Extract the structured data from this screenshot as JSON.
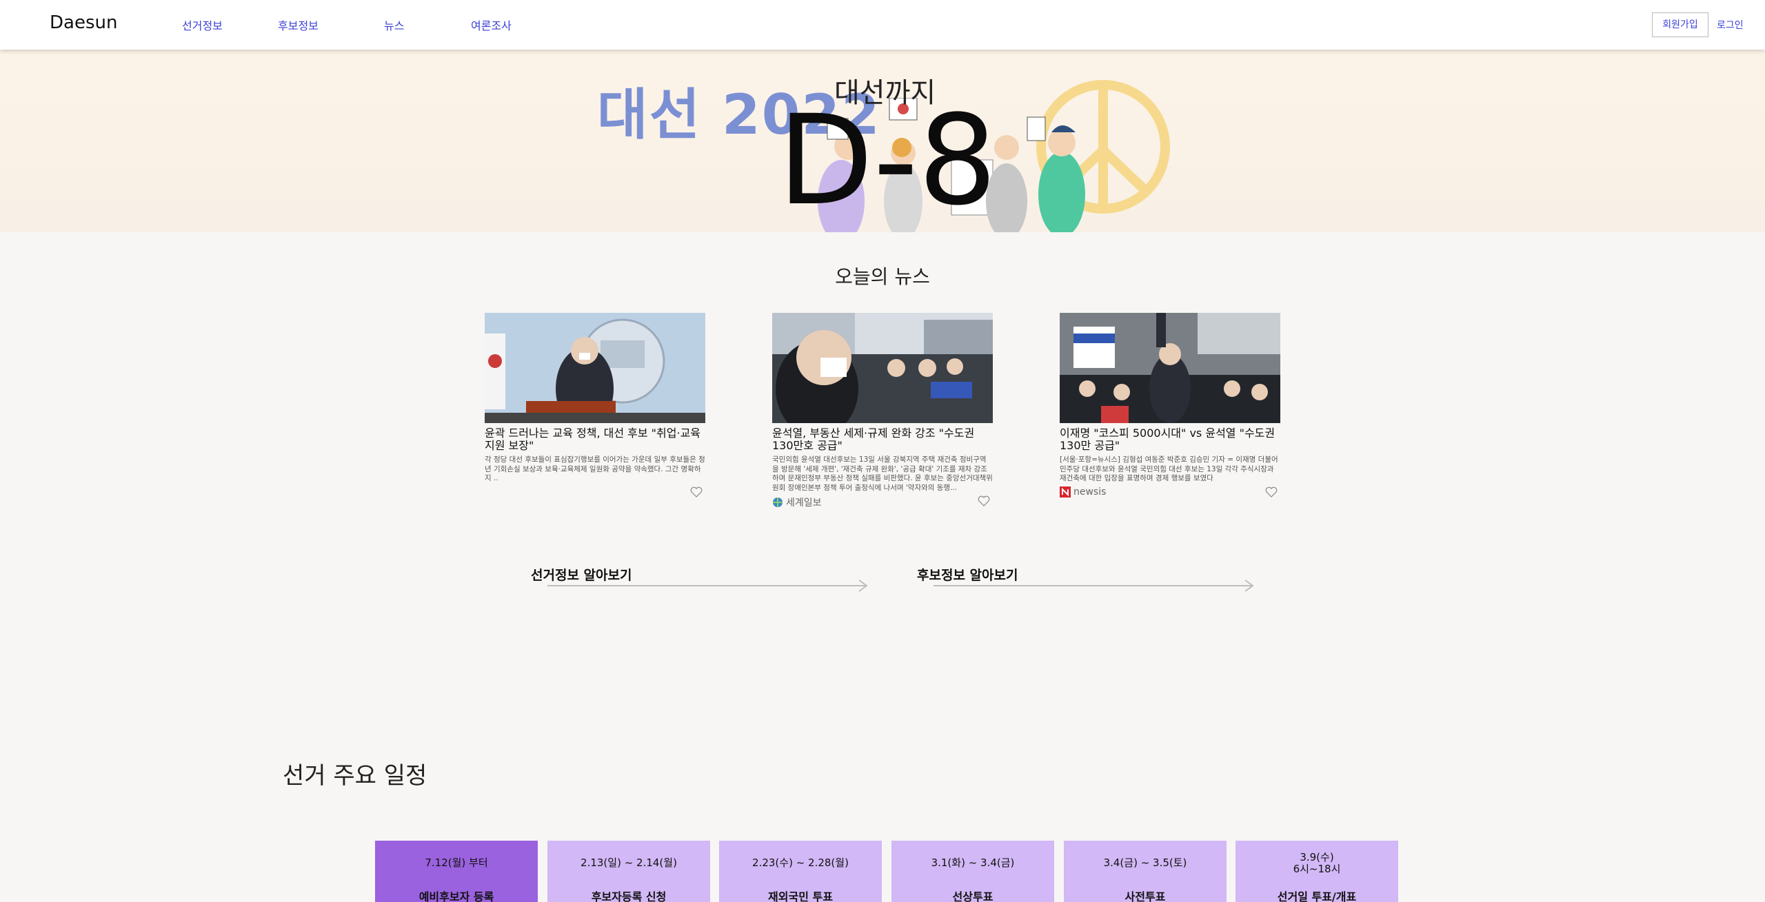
{
  "header": {
    "logo": "Daesun",
    "nav": [
      "선거정보",
      "후보정보",
      "뉴스",
      "여론조사"
    ],
    "signup_label": "회원가입",
    "login_label": "로그인",
    "link_color": "#3b3fd6"
  },
  "hero": {
    "brand": "대선 2022",
    "label": "대선까지",
    "dday": "D-8",
    "colors": {
      "brand": "#7b8fd3",
      "peace": "#f6d98c"
    }
  },
  "news": {
    "title": "오늘의 뉴스",
    "cards": [
      {
        "title": "윤곽 드러나는 교육 정책, 대선 후보 \"취업·교육 지원 보장\"",
        "body": "각 정당 대선 후보들이 표심잡기행보를 이어가는 가운데 일부 후보들은 청년 기회손실 보상과 보육·교육체제 일원화 공약을 약속했다. 그간 명확하지 ..",
        "source": ""
      },
      {
        "title": "윤석열, 부동산 세제·규제 완화 강조 \"수도권 130만호 공급\"",
        "body": "국민의힘 윤석열 대선후보는 13일 서울 강북지역 주택 재건축 정비구역을 방문해 '세제 개편', '재건축 규제 완화', '공급 확대' 기조를 재차 강조하며 문재인정부 부동산 정책 실패를 비판했다. 윤 후보는 중앙선거대책위원회 장애인본부 정책 투어 출정식에 나서며 '약자와의 동행...",
        "source": "세계일보"
      },
      {
        "title": "이재명 \"코스피 5000시대\" vs 윤석열 \"수도권 130만 공급\"",
        "body": "[서울·포항=뉴시스] 김형섭 여동준 박준호 김승민 기자 = 이재명 더불어민주당 대선후보와 윤석열 국민의힘 대선 후보는 13일 각각 주식시장과 재건축에 대한 입장을 표명하며 경제 행보를 보였다",
        "source": "newsis"
      }
    ]
  },
  "cta": {
    "election_info": "선거정보 알아보기",
    "candidate_info": "후보정보 알아보기"
  },
  "schedule": {
    "title": "선거 주요 일정",
    "items": [
      {
        "date": "7.12(월) 부터",
        "date2": "",
        "name": "예비후보자 등록",
        "color": "#9a62de"
      },
      {
        "date": "2.13(일) ~ 2.14(월)",
        "date2": "",
        "name": "후보자등록 신청",
        "color": "#d2b8f6"
      },
      {
        "date": "2.23(수) ~ 2.28(월)",
        "date2": "",
        "name": "재외국민 투표",
        "color": "#d2b8f6"
      },
      {
        "date": "3.1(화) ~ 3.4(금)",
        "date2": "",
        "name": "선상투표",
        "color": "#d2b8f6"
      },
      {
        "date": "3.4(금) ~ 3.5(토)",
        "date2": "",
        "name": "사전투표",
        "color": "#d2b8f6"
      },
      {
        "date": "3.9(수)",
        "date2": "6시~18시",
        "name": "선거일 투표/개표",
        "color": "#d2b8f6"
      }
    ]
  }
}
